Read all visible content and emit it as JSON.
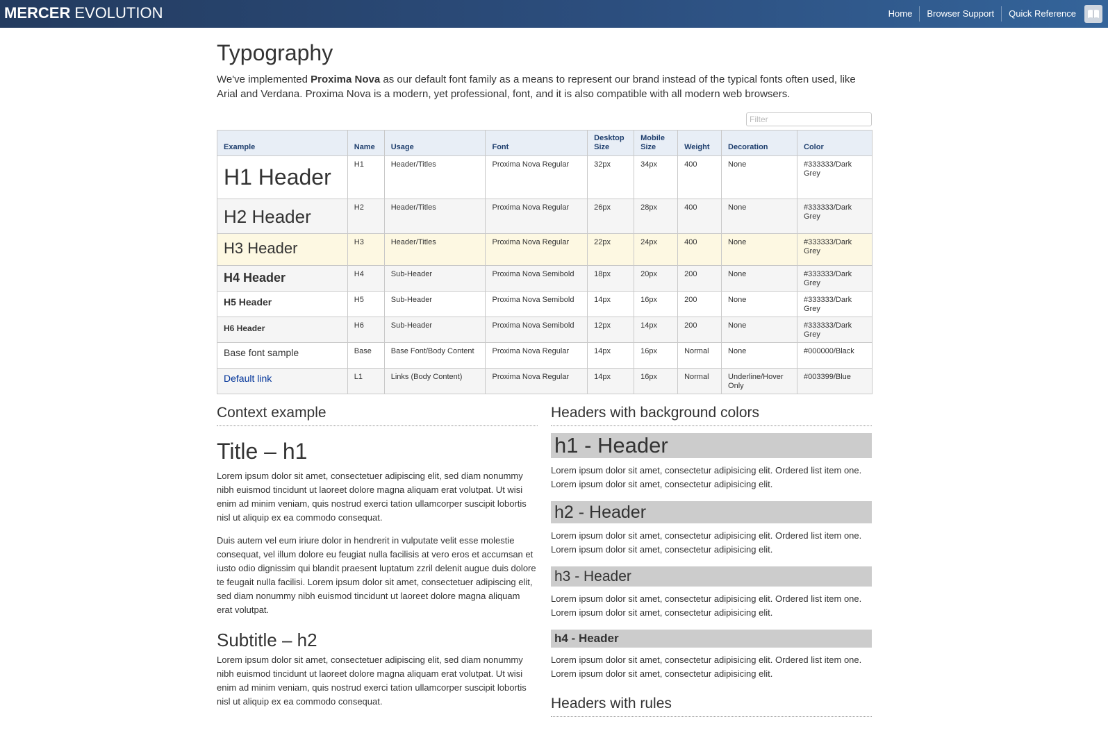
{
  "header": {
    "brand_bold": "MERCER",
    "brand_light": "EVOLUTION",
    "nav": [
      "Home",
      "Browser Support",
      "Quick Reference"
    ],
    "book_icon": "book-icon"
  },
  "page": {
    "title": "Typography",
    "intro_pre": "We've implemented ",
    "intro_bold": "Proxima Nova",
    "intro_post": " as our default font family as a means to represent our brand instead of the typical fonts often used, like Arial and Verdana. Proxima Nova is a modern, yet professional, font, and it is also compatible with all modern web browsers.",
    "filter_placeholder": "Filter"
  },
  "table": {
    "headers": [
      "Example",
      "Name",
      "Usage",
      "Font",
      "Desktop Size",
      "Mobile Size",
      "Weight",
      "Decoration",
      "Color"
    ],
    "rows": [
      {
        "example": "H1 Header",
        "name": "H1",
        "usage": "Header/Titles",
        "font": "Proxima Nova Regular",
        "desktop": "32px",
        "mobile": "34px",
        "weight": "400",
        "decoration": "None",
        "color": "#333333/Dark Grey"
      },
      {
        "example": "H2 Header",
        "name": "H2",
        "usage": "Header/Titles",
        "font": "Proxima Nova Regular",
        "desktop": "26px",
        "mobile": "28px",
        "weight": "400",
        "decoration": "None",
        "color": "#333333/Dark Grey"
      },
      {
        "example": "H3 Header",
        "name": "H3",
        "usage": "Header/Titles",
        "font": "Proxima Nova Regular",
        "desktop": "22px",
        "mobile": "24px",
        "weight": "400",
        "decoration": "None",
        "color": "#333333/Dark Grey"
      },
      {
        "example": "H4 Header",
        "name": "H4",
        "usage": "Sub-Header",
        "font": "Proxima Nova Semibold",
        "desktop": "18px",
        "mobile": "20px",
        "weight": "200",
        "decoration": "None",
        "color": "#333333/Dark Grey"
      },
      {
        "example": "H5 Header",
        "name": "H5",
        "usage": "Sub-Header",
        "font": "Proxima Nova Semibold",
        "desktop": "14px",
        "mobile": "16px",
        "weight": "200",
        "decoration": "None",
        "color": "#333333/Dark Grey"
      },
      {
        "example": "H6 Header",
        "name": "H6",
        "usage": "Sub-Header",
        "font": "Proxima Nova Semibold",
        "desktop": "12px",
        "mobile": "14px",
        "weight": "200",
        "decoration": "None",
        "color": "#333333/Dark Grey"
      },
      {
        "example": "Base font sample",
        "name": "Base",
        "usage": "Base Font/Body Content",
        "font": "Proxima Nova Regular",
        "desktop": "14px",
        "mobile": "16px",
        "weight": "Normal",
        "decoration": "None",
        "color": "#000000/Black"
      },
      {
        "example": "Default link",
        "name": "L1",
        "usage": "Links (Body Content)",
        "font": "Proxima Nova Regular",
        "desktop": "14px",
        "mobile": "16px",
        "weight": "Normal",
        "decoration": "Underline/Hover Only",
        "color": "#003399/Blue"
      }
    ]
  },
  "context": {
    "section_title": "Context example",
    "h1": "Title – h1",
    "p1": "Lorem ipsum dolor sit amet, consectetuer adipiscing elit, sed diam nonummy nibh euismod tincidunt ut laoreet dolore magna aliquam erat volutpat. Ut wisi enim ad minim veniam, quis nostrud exerci tation ullamcorper suscipit lobortis nisl ut aliquip ex ea commodo consequat.",
    "p2": "Duis autem vel eum iriure dolor in hendrerit in vulputate velit esse molestie consequat, vel illum dolore eu feugiat nulla facilisis at vero eros et accumsan et iusto odio dignissim qui blandit praesent luptatum zzril delenit augue duis dolore te feugait nulla facilisi. Lorem ipsum dolor sit amet, consectetuer adipiscing elit, sed diam nonummy nibh euismod tincidunt ut laoreet dolore magna aliquam erat volutpat.",
    "h2": "Subtitle – h2",
    "p3": "Lorem ipsum dolor sit amet, consectetuer adipiscing elit, sed diam nonummy nibh euismod tincidunt ut laoreet dolore magna aliquam erat volutpat. Ut wisi enim ad minim veniam, quis nostrud exerci tation ullamcorper suscipit lobortis nisl ut aliquip ex ea commodo consequat."
  },
  "bgheaders": {
    "section_title": "Headers with background colors",
    "h1": "h1 - Header",
    "h2": "h2 - Header",
    "h3": "h3 - Header",
    "h4": "h4 - Header",
    "para": "Lorem ipsum dolor sit amet, consectetur adipisicing elit. Ordered list item one. Lorem ipsum dolor sit amet, consectetur adipisicing elit.",
    "rules_title": "Headers with rules"
  },
  "colors": {
    "topbar_start": "#233b5f",
    "topbar_end": "#34649a",
    "table_header_bg": "#e8eef6",
    "highlight_row": "#fdf8e2",
    "link": "#003399",
    "bg_header": "#cccccc"
  }
}
